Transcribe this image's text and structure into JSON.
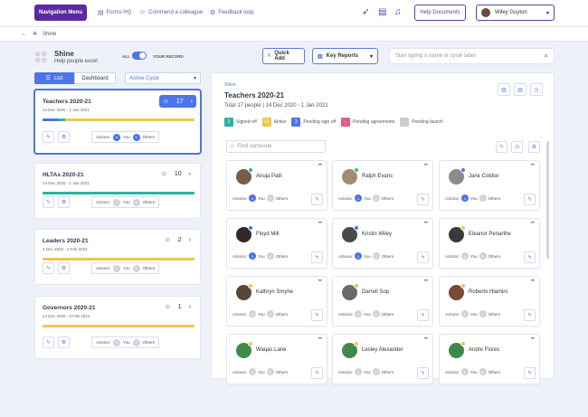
{
  "topbar": {
    "nav_menu": "Navigation Menu",
    "links": [
      {
        "label": "Forms HQ",
        "icon": "document-icon"
      },
      {
        "label": "Commend a colleague",
        "icon": "people-icon"
      },
      {
        "label": "Feedback loop",
        "icon": "gear-icon"
      }
    ],
    "help": "Help Documents",
    "user": "Wiley Guyton"
  },
  "breadcrumb": {
    "current": "Shine"
  },
  "app": {
    "title": "Shine",
    "subtitle": "Help people excel"
  },
  "toggle": {
    "left": "ALL",
    "right": "YOUR RECORD"
  },
  "buttons": {
    "quick_add": "Quick Add",
    "key_reports": "Key Reports"
  },
  "search": {
    "placeholder": "Start typing a name or cycle label"
  },
  "view_tabs": {
    "list": "List",
    "dashboard": "Dashboard"
  },
  "cycle_select": {
    "value": "Active Cycle"
  },
  "cycles": [
    {
      "title": "Teachers 2020-21",
      "dates": "14 Dec 2020 - 1 Jan 2021",
      "count": "17",
      "actions_label": "Actions:",
      "you": "0",
      "you_label": "You",
      "others": "4",
      "others_label": "Others",
      "progress_blue": 0.1,
      "progress_teal": 0.05
    },
    {
      "title": "HLTAs 2020-21",
      "dates": "14 Dec 2020 - 1 Jan 2021",
      "count": "10",
      "actions_label": "Actions:",
      "you": "0",
      "you_label": "You",
      "others": "0",
      "others_label": "Others",
      "progress_blue": 0,
      "progress_teal": 1.0
    },
    {
      "title": "Leaders 2020-21",
      "dates": "4 Dec 2020 - 5 Feb 2021",
      "count": "2",
      "actions_label": "Actions:",
      "you": "0",
      "you_label": "You",
      "others": "0",
      "others_label": "Others",
      "progress_blue": 0,
      "progress_teal": 0
    },
    {
      "title": "Governors 2020-21",
      "dates": "14 Dec 2020 - 5 Feb 2021",
      "count": "1",
      "actions_label": "Actions:",
      "you": "0",
      "you_label": "You",
      "others": "0",
      "others_label": "Others",
      "progress_blue": 0,
      "progress_teal": 0
    }
  ],
  "main": {
    "crumb": "Shine",
    "title": "Teachers 2020-21",
    "subtitle": "Total 17 people | 14 Dec 2020 - 1 Jan 2021",
    "legend": [
      {
        "count": "2",
        "label": "Signed-off",
        "color": "#2db3a0"
      },
      {
        "count": "12",
        "label": "Active",
        "color": "#f0c550"
      },
      {
        "count": "3",
        "label": "Pending sign off",
        "color": "#4f73e8"
      },
      {
        "count": "-",
        "label": "Pending agreements",
        "color": "#e0607e"
      },
      {
        "count": "-",
        "label": "Pending launch",
        "color": "#c9ccd4"
      }
    ],
    "find_placeholder": "Find someone"
  },
  "people": [
    {
      "name": "Anuja Patil",
      "status": "#2db3a0",
      "avatar": "#7a5a48",
      "you": "1",
      "others": "0"
    },
    {
      "name": "Ralph Evans",
      "status": "#2db3a0",
      "avatar": "#a58a72",
      "you": "1",
      "others": "0"
    },
    {
      "name": "Jane Coldse",
      "status": "#4f73e8",
      "avatar": "#8c8c8c",
      "you": "1",
      "others": "0"
    },
    {
      "name": "Floyd Mill",
      "status": "#4f73e8",
      "avatar": "#2f2a28",
      "you": "1",
      "others": "0"
    },
    {
      "name": "Kristin Wiley",
      "status": "#4f73e8",
      "avatar": "#4a4a4a",
      "you": "1",
      "others": "0"
    },
    {
      "name": "Eleanor Penarthe",
      "status": "#f0c550",
      "avatar": "#3a3a3a",
      "you": "0",
      "others": "0"
    },
    {
      "name": "Kathryn Smyhe",
      "status": "#f0c550",
      "avatar": "#5a4634",
      "you": "0",
      "others": "0"
    },
    {
      "name": "Darrell Sop",
      "status": "#f0c550",
      "avatar": "#6a6a6a",
      "you": "0",
      "others": "0"
    },
    {
      "name": "Roberto Hlamini",
      "status": "#f0c550",
      "avatar": "#7a4a38",
      "you": "0",
      "others": "0"
    },
    {
      "name": "Waqas Lane",
      "status": "#f0c550",
      "avatar": "#3f8a4a",
      "you": "0",
      "others": "0"
    },
    {
      "name": "Lesley  Alexander",
      "status": "#f0c550",
      "avatar": "#3f8a4a",
      "you": "0",
      "others": "0"
    },
    {
      "name": "Andre Flores",
      "status": "#f0c550",
      "avatar": "#3f8a4a",
      "you": "0",
      "others": "0"
    }
  ],
  "card_labels": {
    "actions": "Actions:",
    "you": "You",
    "others": "Others"
  }
}
